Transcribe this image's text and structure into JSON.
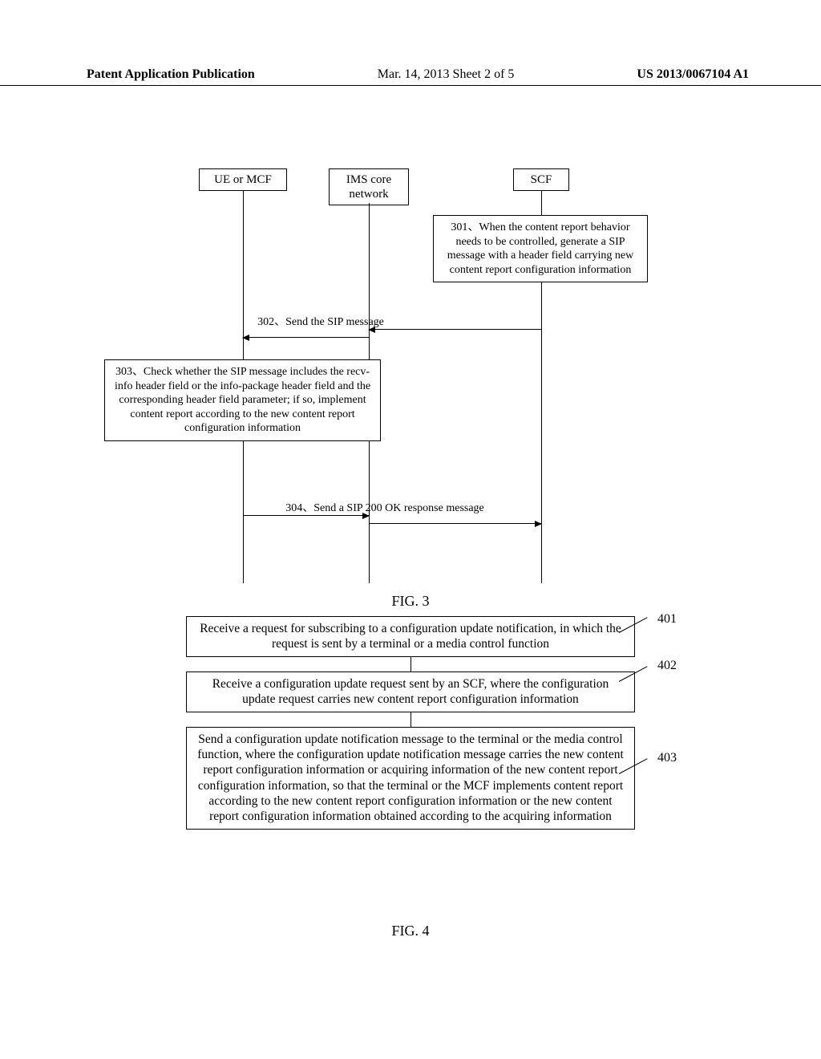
{
  "header": {
    "left": "Patent Application Publication",
    "middle": "Mar. 14, 2013  Sheet 2 of 5",
    "right": "US 2013/0067104 A1"
  },
  "fig3": {
    "lifelines": {
      "ue": "UE or MCF",
      "ims": "IMS core\nnetwork",
      "scf": "SCF"
    },
    "note301": "301、When the content report behavior needs to be controlled, generate a SIP message with a header field carrying new content report configuration information",
    "msg302": "302、Send the SIP message",
    "note303": "303、Check whether the SIP message includes the recv-info header field or the info-package header field and the corresponding header field parameter; if so, implement content report according to the new content report configuration information",
    "msg304": "304、Send a SIP 200 OK response message",
    "label": "FIG. 3"
  },
  "fig4": {
    "step401": "Receive a request for subscribing to a configuration update notification, in which the request is sent by a terminal or a media control function",
    "tag401": "401",
    "step402": "Receive a configuration update request sent by an SCF, where the configuration update request carries new content report configuration information",
    "tag402": "402",
    "step403": "Send a configuration update notification message to the terminal or the media control function, where the configuration update notification message carries the new content report configuration information or acquiring information of the new content report configuration information, so that the terminal or the MCF implements content report according to the new content report configuration information or the new content report configuration information obtained according to the acquiring information",
    "tag403": "403",
    "label": "FIG. 4"
  }
}
